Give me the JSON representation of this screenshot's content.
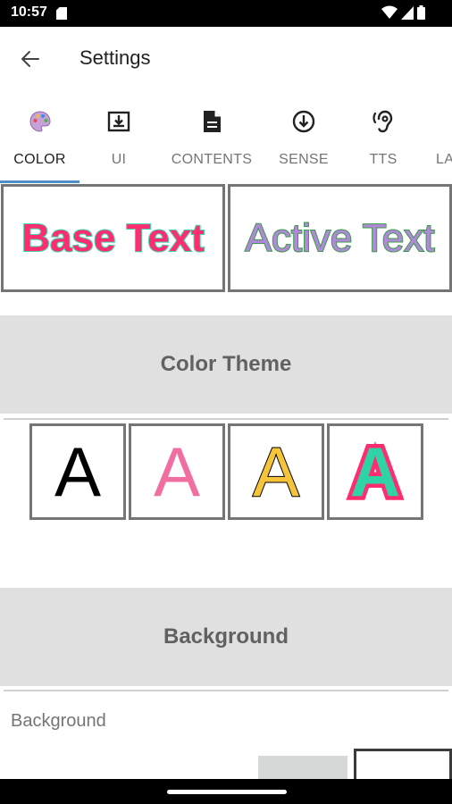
{
  "status_bar": {
    "time": "10:57"
  },
  "app_bar": {
    "title": "Settings"
  },
  "tabs": [
    {
      "label": "COLOR",
      "icon": "palette-icon",
      "active": true
    },
    {
      "label": "UI",
      "icon": "download-box-icon",
      "active": false
    },
    {
      "label": "CONTENTS",
      "icon": "document-icon",
      "active": false
    },
    {
      "label": "SENSE",
      "icon": "arrow-down-circle-icon",
      "active": false
    },
    {
      "label": "TTS",
      "icon": "ear-icon",
      "active": false
    },
    {
      "label": "LA",
      "icon": "",
      "active": false
    }
  ],
  "preview": {
    "base_text": "Base Text",
    "active_text": "Active Text"
  },
  "sections": {
    "color_theme": "Color Theme",
    "background": "Background"
  },
  "themes": [
    {
      "letter": "A",
      "fill": "#000000",
      "stroke": "none"
    },
    {
      "letter": "A",
      "fill": "#f06fa0",
      "stroke": "none"
    },
    {
      "letter": "A",
      "fill": "#f5c43a",
      "stroke": "#000000"
    },
    {
      "letter": "A",
      "fill": "#2fd3a5",
      "stroke": "#ff2d6f"
    }
  ],
  "background_row": {
    "label": "Background"
  },
  "colors": {
    "accent": "#4f8ec9",
    "header_bg": "#e0e0e0",
    "border": "#757575"
  }
}
